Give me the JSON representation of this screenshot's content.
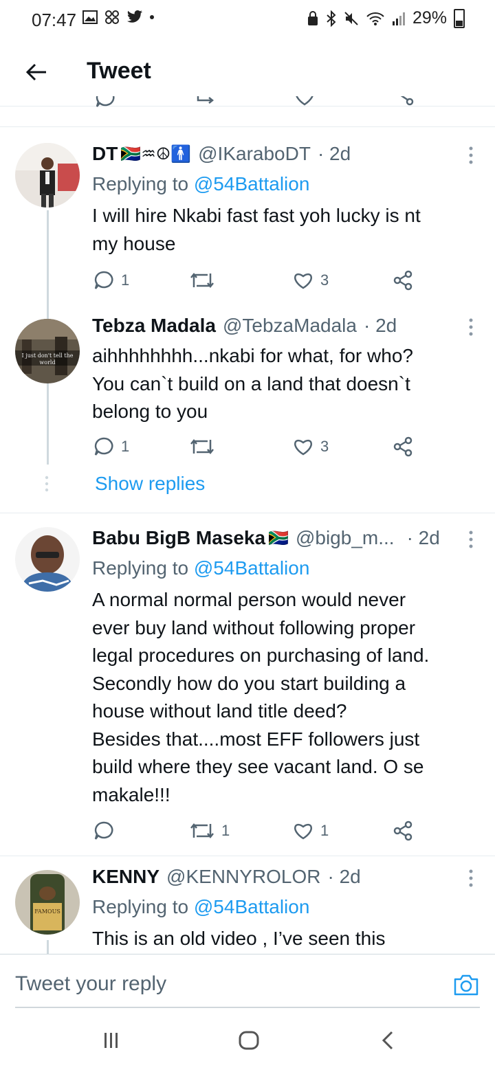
{
  "status_bar": {
    "time": "07:47",
    "battery": "29%"
  },
  "header": {
    "title": "Tweet"
  },
  "tweets": [
    {
      "name": "DT",
      "name_suffix": "🇿🇦♒☮🚹",
      "handle": "@IKaraboDT",
      "time": "· 2d",
      "replying_prefix": "Replying to ",
      "replying_to": "@54Battalion",
      "text": "I will hire Nkabi fast fast yoh lucky is nt\nmy house",
      "replies": "1",
      "retweets": "",
      "likes": "3"
    },
    {
      "name": "Tebza Madala",
      "handle": "@TebzaMadala",
      "time": "· 2d",
      "avatar_caption": "I just don't tell the world",
      "text": "aihhhhhhhh...nkabi for what, for who?\nYou can`t build on a land that doesn`t\nbelong to you",
      "replies": "1",
      "retweets": "",
      "likes": "3"
    },
    {
      "name": "Babu BigB Maseka",
      "name_suffix": "🇿🇦",
      "handle": "@bigb_m...",
      "time": "· 2d",
      "replying_prefix": "Replying to ",
      "replying_to": "@54Battalion",
      "text": "A normal normal person would never\never buy land without following proper\nlegal procedures on purchasing of land.\nSecondly how do you start building a\nhouse without land title deed?\nBesides that....most EFF followers just\nbuild where they see vacant land. O se\nmakale!!!",
      "replies": "",
      "retweets": "1",
      "likes": "1"
    },
    {
      "name": "KENNY",
      "handle": "@KENNYROLOR",
      "time": "· 2d",
      "avatar_caption": "FAMOUS",
      "replying_prefix": "Replying to ",
      "replying_to": "@54Battalion",
      "text": "This is an old video , I’ve seen this"
    }
  ],
  "show_replies": "Show replies",
  "reply_bar": {
    "placeholder": "Tweet your reply"
  },
  "colors": {
    "accent": "#1d9bf0",
    "secondary": "#536471",
    "text": "#0f1419",
    "divider": "#e6ecf0"
  }
}
